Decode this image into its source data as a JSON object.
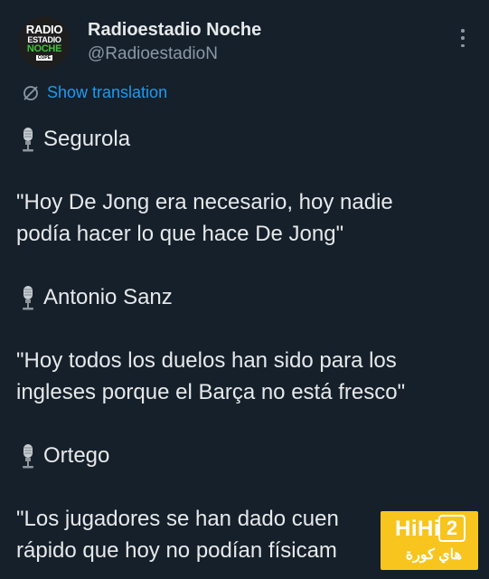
{
  "account": {
    "avatar_line1": "RADIO",
    "avatar_line2": "ESTADIO",
    "avatar_line3": "NOCHE",
    "avatar_line4": "COPE",
    "name": "Radioestadio Noche",
    "handle": "@RadioestadioN"
  },
  "translation": {
    "label": "Show translation",
    "icon": "globe-slash-icon"
  },
  "tweet": {
    "speaker1": "Segurola",
    "quote1_line1": "\"Hoy De Jong era necesario, hoy nadie",
    "quote1_line2": "podía hacer lo que hace De Jong\"",
    "speaker2": "Antonio Sanz",
    "quote2_line1": "\"Hoy todos los duelos han sido para los",
    "quote2_line2": "ingleses porque el Barça no está fresco\"",
    "speaker3": "Ortego",
    "quote3_line1": "\"Los jugadores se han dado cuen",
    "quote3_line2": "rápido que hoy no podían físicam",
    "mic_icon": "studio-microphone-icon"
  },
  "watermark": {
    "brand": "HiHi",
    "number": "2",
    "arabic": "هاي كورة"
  },
  "colors": {
    "background": "#15202b",
    "link": "#1d9bf0",
    "muted": "#8b98a5",
    "watermark": "#f7c51e"
  }
}
